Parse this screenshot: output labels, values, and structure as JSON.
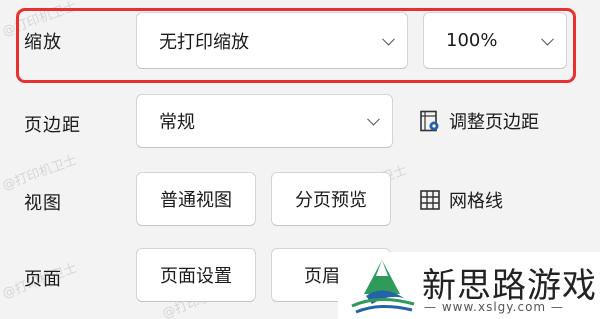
{
  "zoom": {
    "label": "缩放",
    "scale_value": "无打印缩放",
    "percent_value": "100%"
  },
  "margins": {
    "label": "页边距",
    "value": "常规",
    "adjust_label": "调整页边距"
  },
  "view": {
    "label": "视图",
    "normal_label": "普通视图",
    "pagebreak_label": "分页预览",
    "gridlines_label": "网格线"
  },
  "page": {
    "label": "页面",
    "setup_label": "页面设置",
    "header_label": "页眉页"
  },
  "watermark": {
    "text": "@打印机卫士"
  },
  "logo": {
    "title": "新思路游戏",
    "subtitle": "— www.xslgy.com —"
  },
  "colors": {
    "highlight": "#e5322f",
    "logo_green": "#2f9b5a",
    "logo_blue": "#2563a8"
  }
}
